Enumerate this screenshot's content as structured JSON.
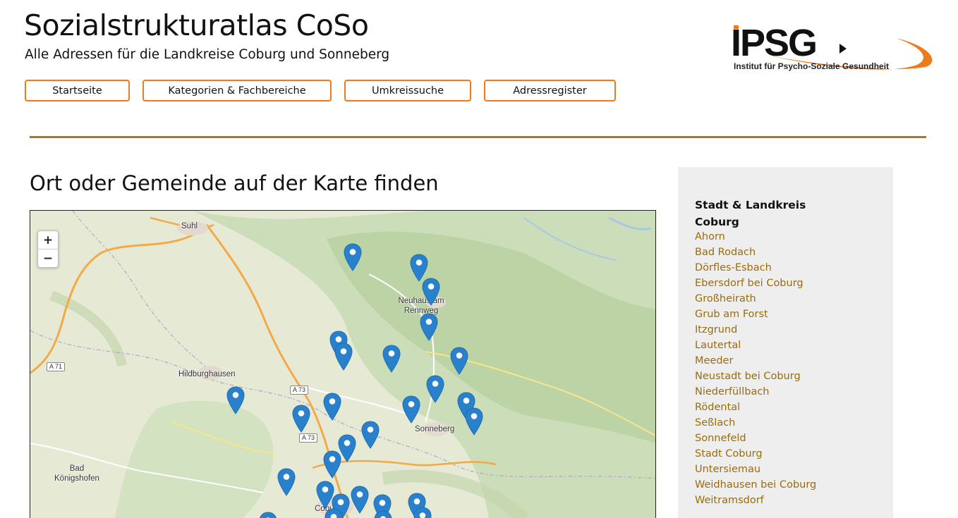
{
  "header": {
    "title": "Sozialstrukturatlas CoSo",
    "subtitle": "Alle Adressen für die Landkreise Coburg und Sonneberg"
  },
  "logo": {
    "wordmark": "IPSG",
    "caption": "Institut für Psycho-Soziale Gesundheit",
    "accent_color": "#ee7a1c"
  },
  "nav": {
    "items": [
      {
        "label": "Startseite"
      },
      {
        "label": "Kategorien & Fachbereiche"
      },
      {
        "label": "Umkreissuche"
      },
      {
        "label": "Adressregister"
      }
    ],
    "border_color": "#ee7a1c"
  },
  "main": {
    "heading": "Ort oder Gemeinde auf der Karte finden"
  },
  "map": {
    "zoom_in": "+",
    "zoom_out": "−",
    "places": [
      "Suhl",
      "Neuhaus am Rennweg",
      "Hildburghausen",
      "Sonneberg",
      "Bad Königshofen",
      "Coburg"
    ],
    "roads": [
      "A 71",
      "A 73",
      "A 73"
    ],
    "marker_color": "#2a81cb",
    "marker_count": 28
  },
  "sidebar": {
    "heading": "Stadt & Landkreis Coburg",
    "link_color": "#9a6c0a",
    "items": [
      "Ahorn",
      "Bad Rodach",
      "Dörfles-Esbach",
      "Ebersdorf bei Coburg",
      "Großheirath",
      "Grub am Forst",
      "Itzgrund",
      "Lautertal",
      "Meeder",
      "Neustadt bei Coburg",
      "Niederfüllbach",
      "Rödental",
      "Seßlach",
      "Sonnefeld",
      "Stadt Coburg",
      "Untersiemau",
      "Weidhausen bei Coburg",
      "Weitramsdorf"
    ]
  }
}
